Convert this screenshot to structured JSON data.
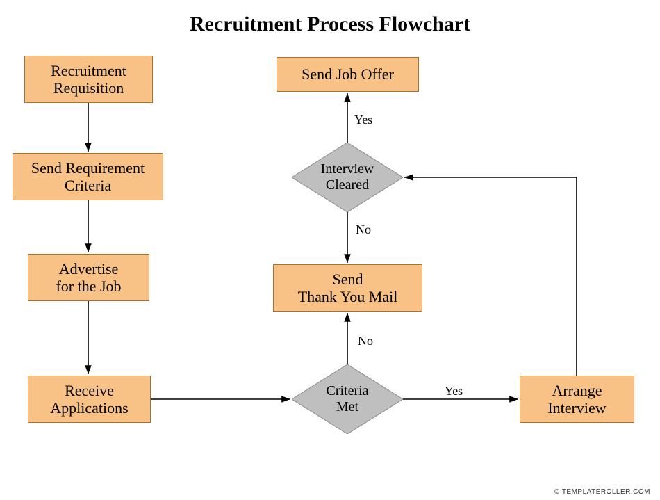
{
  "title": "Recruitment Process Flowchart",
  "footer": "© TEMPLATEROLLER.COM",
  "colors": {
    "process_fill": "#f8c287",
    "process_border": "#a86f2e",
    "decision_fill": "#bfbfbf",
    "decision_border": "#8a8a8a",
    "connector": "#000000"
  },
  "nodes": {
    "recruitment_requisition": {
      "type": "process",
      "label": "Recruitment\nRequisition"
    },
    "send_requirement_criteria": {
      "type": "process",
      "label": "Send Requirement\nCriteria"
    },
    "advertise_job": {
      "type": "process",
      "label": "Advertise\nfor the Job"
    },
    "receive_applications": {
      "type": "process",
      "label": "Receive\nApplications"
    },
    "criteria_met": {
      "type": "decision",
      "label": "Criteria\nMet"
    },
    "arrange_interview": {
      "type": "process",
      "label": "Arrange\nInterview"
    },
    "interview_cleared": {
      "type": "decision",
      "label": "Interview\nCleared"
    },
    "send_thank_you_mail": {
      "type": "process",
      "label": "Send\nThank You Mail"
    },
    "send_job_offer": {
      "type": "process",
      "label": "Send Job Offer"
    }
  },
  "edges": [
    {
      "from": "recruitment_requisition",
      "to": "send_requirement_criteria",
      "label": ""
    },
    {
      "from": "send_requirement_criteria",
      "to": "advertise_job",
      "label": ""
    },
    {
      "from": "advertise_job",
      "to": "receive_applications",
      "label": ""
    },
    {
      "from": "receive_applications",
      "to": "criteria_met",
      "label": ""
    },
    {
      "from": "criteria_met",
      "to": "arrange_interview",
      "label": "Yes"
    },
    {
      "from": "criteria_met",
      "to": "send_thank_you_mail",
      "label": "No"
    },
    {
      "from": "arrange_interview",
      "to": "interview_cleared",
      "label": ""
    },
    {
      "from": "interview_cleared",
      "to": "send_job_offer",
      "label": "Yes"
    },
    {
      "from": "interview_cleared",
      "to": "send_thank_you_mail",
      "label": "No"
    }
  ],
  "edge_labels": {
    "criteria_yes": "Yes",
    "criteria_no": "No",
    "interview_yes": "Yes",
    "interview_no": "No"
  }
}
